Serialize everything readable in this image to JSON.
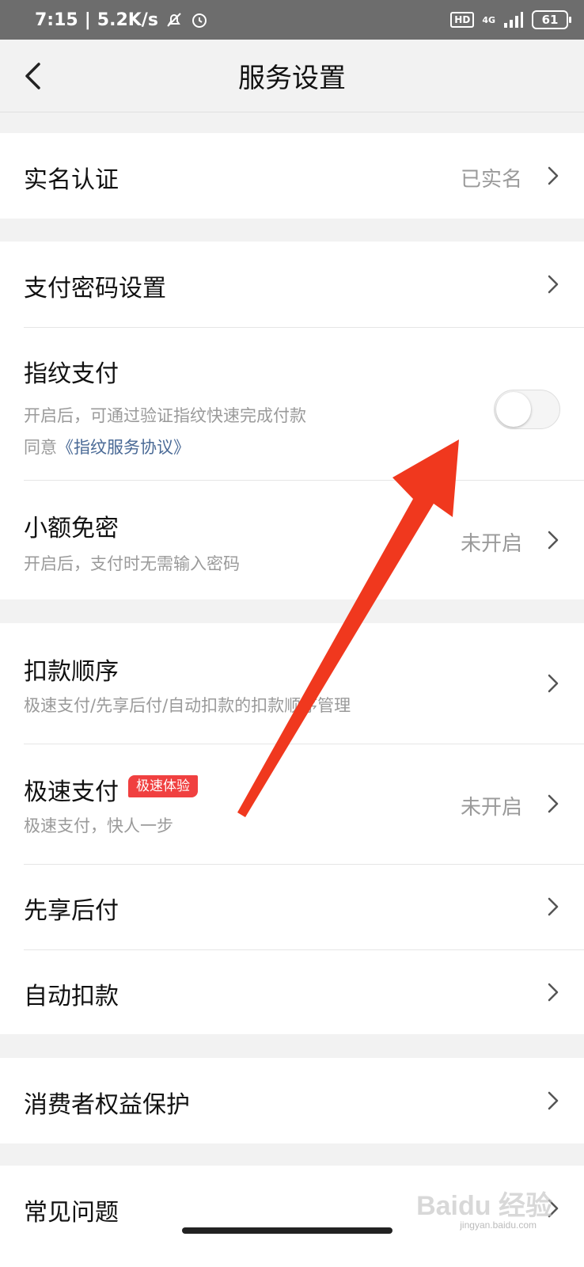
{
  "status_bar": {
    "time": "7:15",
    "speed": "5.2K/s",
    "hd": "HD",
    "network": "4G",
    "battery": "61"
  },
  "header": {
    "title": "服务设置"
  },
  "rows": {
    "real_name": {
      "title": "实名认证",
      "value": "已实名"
    },
    "pay_password": {
      "title": "支付密码设置"
    },
    "fingerprint": {
      "title": "指纹支付",
      "subtitle": "开启后，可通过验证指纹快速完成付款",
      "agree_prefix": "同意",
      "agree_link": "《指纹服务协议》",
      "enabled": false
    },
    "small_free": {
      "title": "小额免密",
      "subtitle": "开启后，支付时无需输入密码",
      "value": "未开启"
    },
    "deduct_order": {
      "title": "扣款顺序",
      "subtitle": "极速支付/先享后付/自动扣款的扣款顺序管理"
    },
    "fast_pay": {
      "title": "极速支付",
      "badge": "极速体验",
      "subtitle": "极速支付，快人一步",
      "value": "未开启"
    },
    "pay_later": {
      "title": "先享后付"
    },
    "auto_deduct": {
      "title": "自动扣款"
    },
    "consumer_rights": {
      "title": "消费者权益保护"
    },
    "faq": {
      "title": "常见问题"
    }
  },
  "watermark": {
    "brand": "Baidu 经验",
    "url": "jingyan.baidu.com"
  },
  "colors": {
    "background": "#f2f2f2",
    "status_bar": "#6d6d6d",
    "badge": "#f04040",
    "link": "#4a6a96",
    "annotation_arrow": "#f0381e"
  },
  "icons": [
    "back-icon",
    "chevron-right-icon",
    "silent-bell-icon",
    "alarm-icon",
    "signal-icon",
    "battery-icon"
  ]
}
